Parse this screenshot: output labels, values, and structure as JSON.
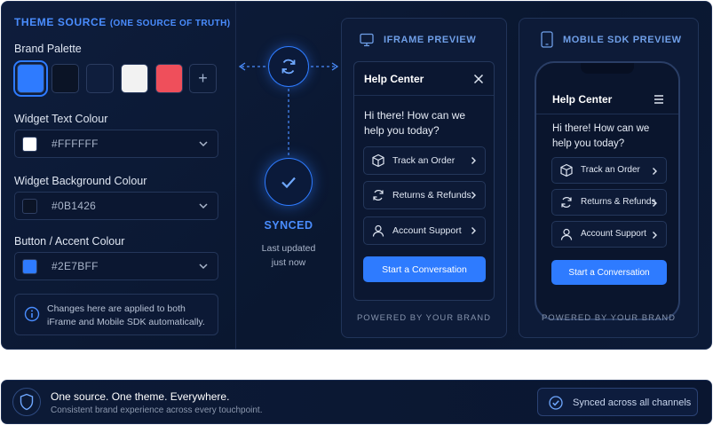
{
  "theme_source": {
    "title": "THEME SOURCE",
    "subtitle": "(ONE SOURCE OF TRUTH)",
    "palette_label": "Brand Palette",
    "palette": [
      "#2E7BFF",
      "#0B1426",
      "#0F1E3D",
      "#F2F2F2",
      "#EF4F5B"
    ],
    "add_label": "+",
    "text_colour": {
      "label": "Widget Text Colour",
      "value": "#FFFFFF"
    },
    "bg_colour": {
      "label": "Widget Background Colour",
      "value": "#0B1426"
    },
    "accent_colour": {
      "label": "Button / Accent Colour",
      "value": "#2E7BFF"
    },
    "info": "Changes here are applied to both iFrame and Mobile SDK automatically."
  },
  "sync": {
    "status": "SYNCED",
    "updated_line1": "Last updated",
    "updated_line2": "just now"
  },
  "iframe": {
    "title": "IFRAME PREVIEW",
    "header": "Help Center",
    "greeting_line1": "Hi there! How can we",
    "greeting_line2": "help you today?",
    "options": [
      "Track an Order",
      "Returns & Refunds",
      "Account Support"
    ],
    "cta": "Start a Conversation",
    "powered": "POWERED BY YOUR BRAND"
  },
  "mobile": {
    "title": "MOBILE SDK PREVIEW",
    "header": "Help Center",
    "greeting_line1": "Hi there! How can we",
    "greeting_line2": "help you today?",
    "options": [
      "Track an Order",
      "Returns & Refunds",
      "Account Support"
    ],
    "cta": "Start a Conversation",
    "powered": "POWERED BY YOUR BRAND"
  },
  "footer": {
    "headline": "One source. One theme. Everywhere.",
    "subline": "Consistent brand experience across every touchpoint.",
    "badge": "Synced across all channels"
  },
  "colors": {
    "accent": "#2E7BFF",
    "background": "#0B1426"
  }
}
